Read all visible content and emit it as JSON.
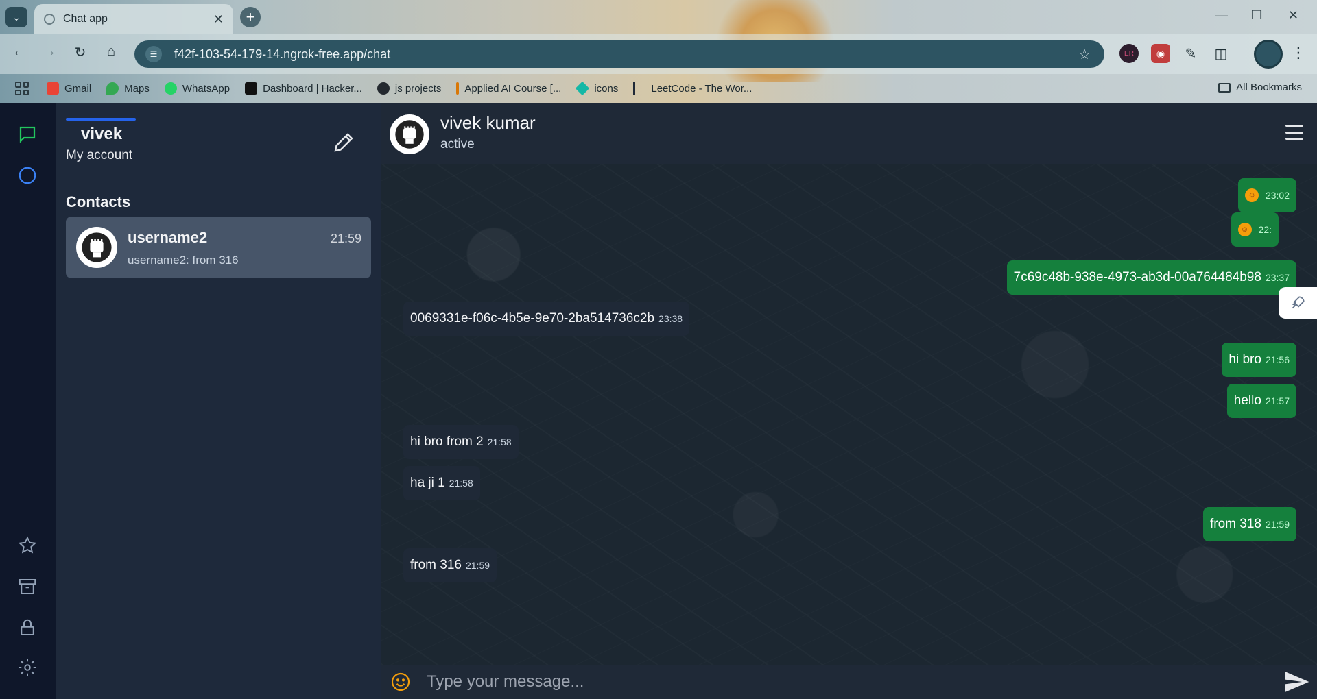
{
  "browser": {
    "tab_title": "Chat app",
    "url": "f42f-103-54-179-14.ngrok-free.app/chat",
    "bookmarks": [
      {
        "label": "Gmail",
        "color": "#ea4335"
      },
      {
        "label": "Maps",
        "color": "#34a853"
      },
      {
        "label": "WhatsApp",
        "color": "#25d366"
      },
      {
        "label": "Dashboard | Hacker...",
        "color": "#111111"
      },
      {
        "label": "js projects",
        "color": "#24292f"
      },
      {
        "label": "Applied AI Course [...",
        "color": "#d97706"
      },
      {
        "label": "icons",
        "color": "#14b8a6"
      },
      {
        "label": "LeetCode - The Wor...",
        "color": "#1f2937"
      }
    ],
    "all_bookmarks": "All Bookmarks"
  },
  "account": {
    "name": "vivek",
    "subtitle": "My account"
  },
  "contacts": {
    "heading": "Contacts",
    "items": [
      {
        "name": "username2",
        "time": "21:59",
        "preview": "username2: from 316"
      }
    ]
  },
  "chat": {
    "name": "vivek kumar",
    "status": "active",
    "input_placeholder": "Type your message...",
    "messages": [
      {
        "text": "",
        "emoji": true,
        "time": "23:02"
      },
      {
        "text": "",
        "emoji": true,
        "time": "22:"
      },
      {
        "text": "7c69c48b-938e-4973-ab3d-00a764484b98",
        "time": "23:37"
      },
      {
        "text": "0069331e-f06c-4b5e-9e70-2ba514736c2b",
        "time": "23:38"
      },
      {
        "text": "hi bro",
        "time": "21:56"
      },
      {
        "text": "hello",
        "time": "21:57"
      },
      {
        "text": "hi bro from 2",
        "time": "21:58"
      },
      {
        "text": "ha ji 1",
        "time": "21:58"
      },
      {
        "text": "from 318",
        "time": "21:59"
      },
      {
        "text": "from 316",
        "time": "21:59"
      }
    ]
  },
  "theme": {
    "accent": "#2563eb",
    "outgoing_bubble": "#15803d",
    "incoming_bubble": "#1f2937",
    "rail_bg": "#0f172a",
    "sidebar_bg": "#1e293b"
  }
}
